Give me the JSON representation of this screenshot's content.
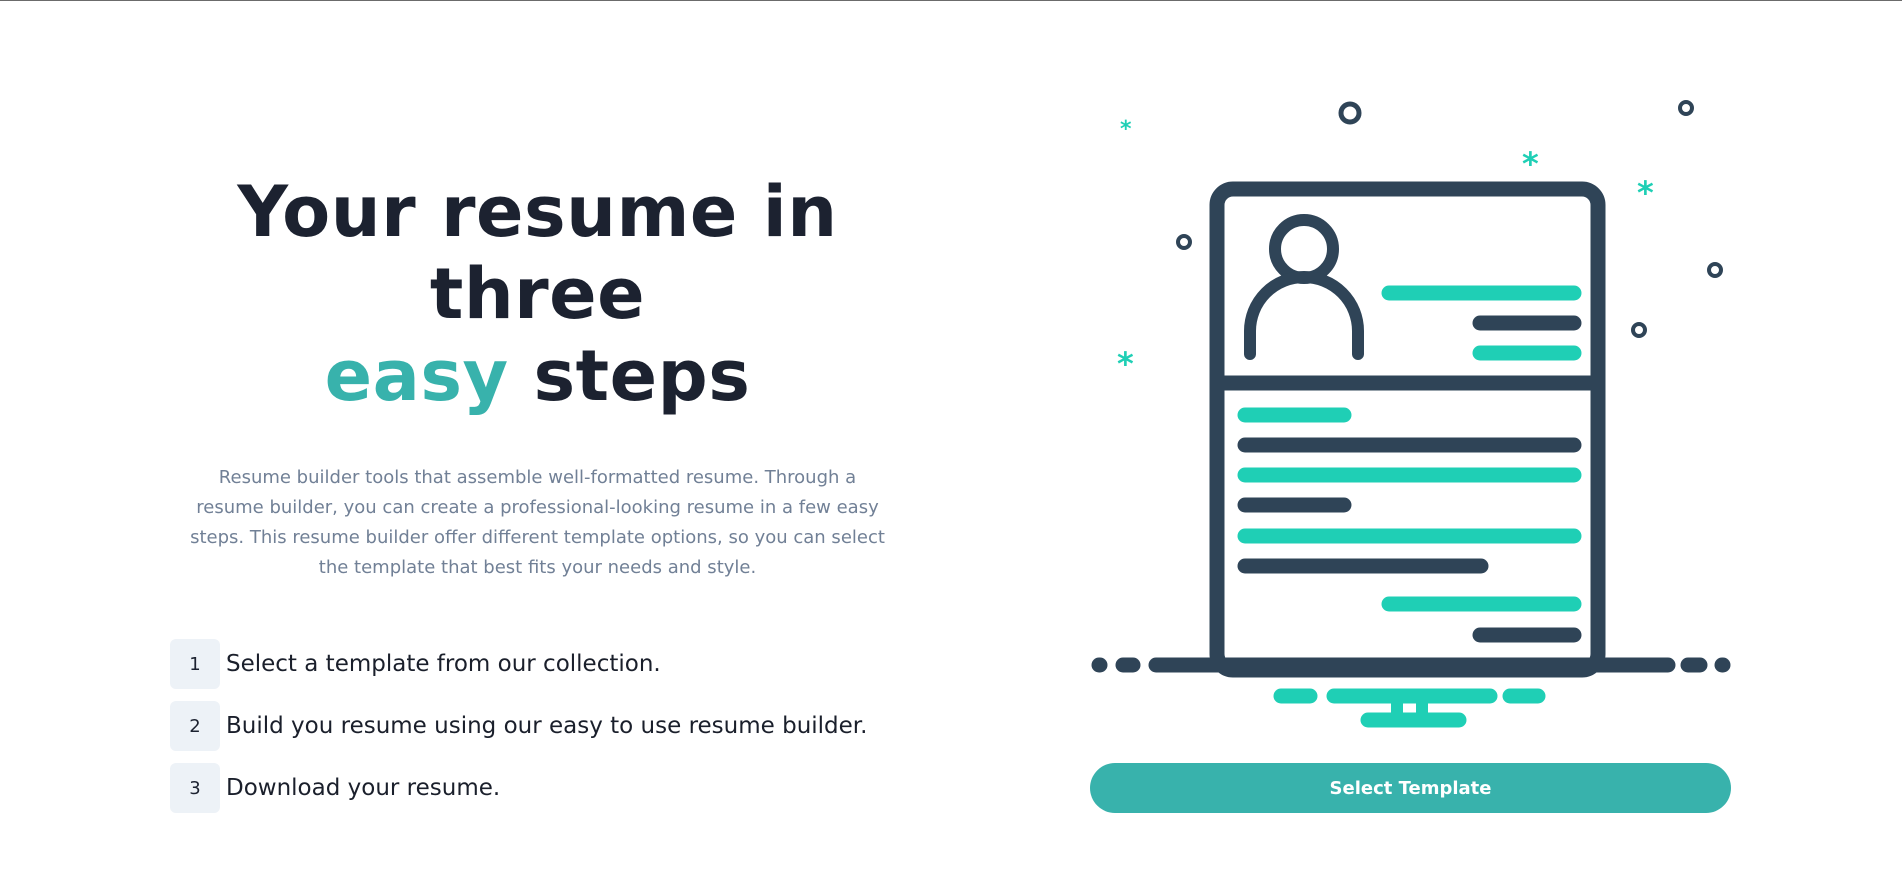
{
  "hero": {
    "headline_line1": "Your resume in three",
    "headline_accent": "easy",
    "headline_rest": "steps",
    "description": "Resume builder tools that assemble well-formatted resume. Through a resume builder, you can create a professional-looking resume in a few easy steps. This resume builder offer different template options, so you can select the template that best fits your needs and style."
  },
  "steps": [
    {
      "number": "1",
      "text": "Select a template from our collection."
    },
    {
      "number": "2",
      "text": "Build you resume using our easy to use resume builder."
    },
    {
      "number": "3",
      "text": "Download your resume."
    }
  ],
  "cta": {
    "label": "Select Template"
  },
  "illustration": {
    "icon": "resume-document-illustration",
    "colors": {
      "dark": "#2f4457",
      "accent": "#1fcfb5"
    }
  },
  "colors": {
    "brand": "#38b2ac",
    "heading": "#1c2230",
    "body_text": "#718096",
    "step_badge_bg": "#edf2f7"
  }
}
